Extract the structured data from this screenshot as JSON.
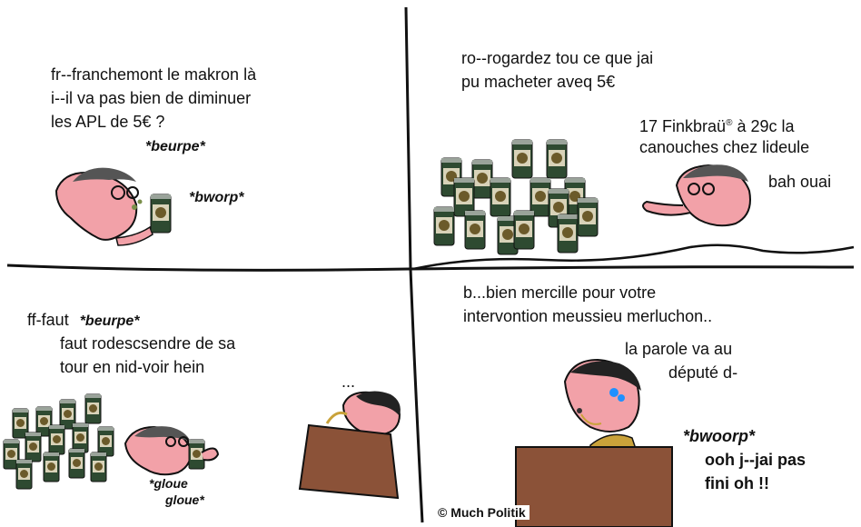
{
  "panel1": {
    "line1": "fr--franchemont le makron là",
    "line2": "i--il va pas bien de diminuer",
    "line3": "les APL de 5€ ?",
    "sfx1": "*beurpe*",
    "sfx2": "*bworp*"
  },
  "panel2": {
    "line1": "ro--rogardez tou ce que jai",
    "line2": "pu macheter aveq 5€",
    "line3a": "17 Finkbraü",
    "reg": "®",
    "line3b": "  à 29c la",
    "line4": "canouches chez lideule",
    "reply": "bah ouai"
  },
  "panel3": {
    "lead": "ff-faut",
    "sfx1": "*beurpe*",
    "line2": "faut rodescsendre de sa",
    "line3": "tour en nid-voir hein",
    "sfx2a": "*gloue",
    "sfx2b": "gloue*",
    "ellipsis": "..."
  },
  "panel4": {
    "line1": "b...bien mercille pour votre",
    "line2": "intervontion meussieu  merluchon..",
    "line3": "la parole va au",
    "line4": "député d-",
    "sfx": "*bwoorp*",
    "reply1": "ooh j--jai pas",
    "reply2": "fini oh !!"
  },
  "credit": "© Much Politik",
  "colors": {
    "skin": "#f2a1a8",
    "can": "#2e4a31",
    "podium": "#8b5238",
    "ink": "#111111"
  }
}
